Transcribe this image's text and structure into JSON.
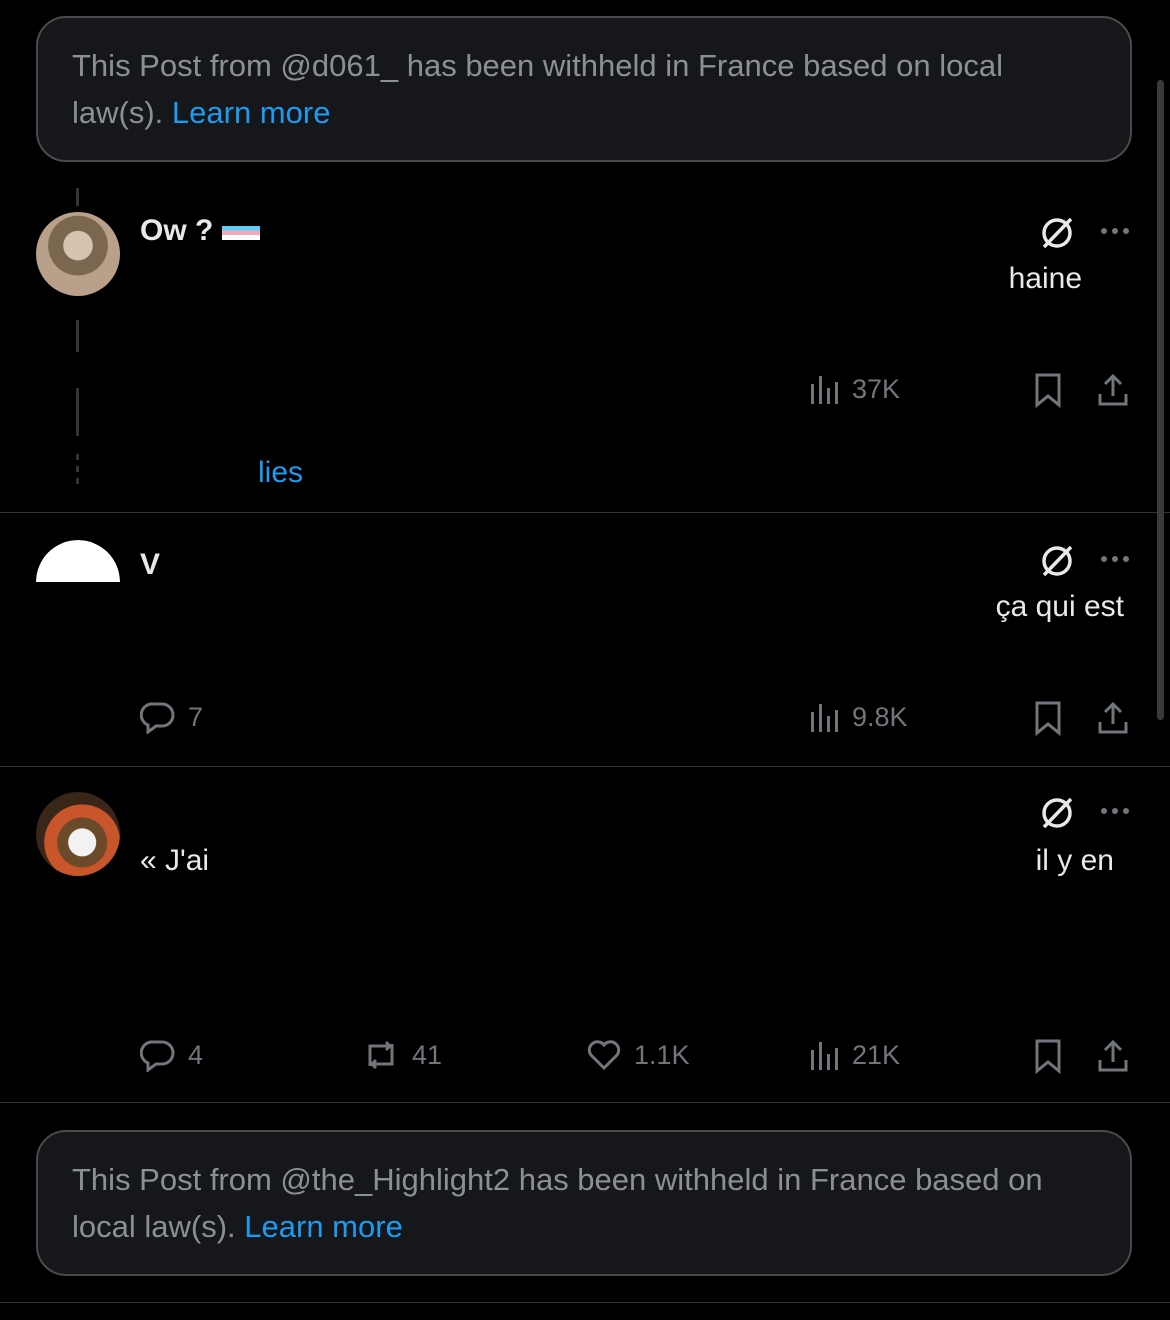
{
  "notices": [
    {
      "text": "This Post from @d061_ has been withheld in France based on local law(s).",
      "link": "Learn more"
    },
    {
      "text": "This Post from @the_Highlight2 has been withheld in France based on local law(s).",
      "link": "Learn more"
    }
  ],
  "posts": [
    {
      "name": "Ow ?",
      "text_visible": "haine",
      "views": "37K",
      "show_replies": "lies"
    },
    {
      "name": "V",
      "text_visible": "ça qui est",
      "replies": "7",
      "views": "9.8K"
    },
    {
      "text_start": "« J'ai",
      "text_visible": "il y en",
      "replies": "4",
      "reposts": "41",
      "likes": "1.1K",
      "views": "21K"
    }
  ],
  "icons": {
    "grok": "slashed-circle-icon",
    "more": "more-icon",
    "reply": "reply-icon",
    "repost": "repost-icon",
    "like": "like-icon",
    "views": "views-icon",
    "bookmark": "bookmark-icon",
    "share": "share-icon"
  },
  "colors": {
    "link": "#1d9bf0",
    "muted": "#71767b",
    "background": "#000000"
  }
}
